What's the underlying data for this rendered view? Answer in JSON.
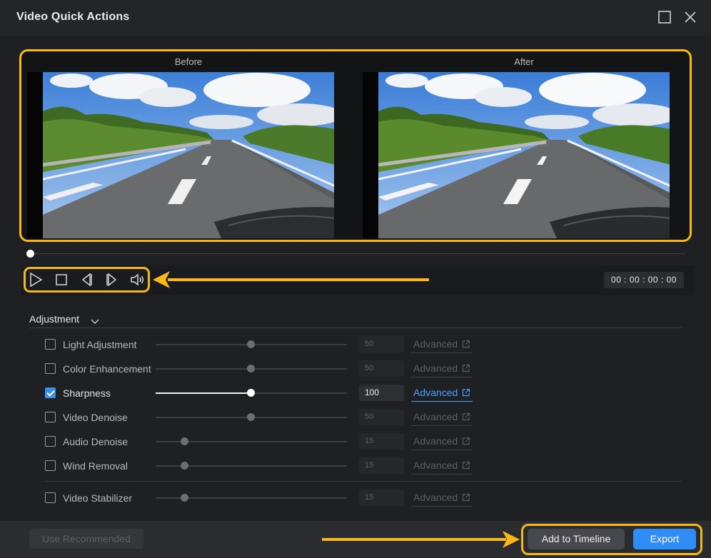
{
  "window": {
    "title": "Video Quick Actions"
  },
  "preview": {
    "before_label": "Before",
    "after_label": "After"
  },
  "player": {
    "timecode": "00 : 00 : 00 : 00",
    "scrub_position": 0.0
  },
  "adjustment": {
    "header": "Adjustment",
    "rows": [
      {
        "label": "Light Adjustment",
        "checked": false,
        "value": "50",
        "slider": 0.5,
        "advanced": "Advanced"
      },
      {
        "label": "Color Enhancement",
        "checked": false,
        "value": "50",
        "slider": 0.5,
        "advanced": "Advanced"
      },
      {
        "label": "Sharpness",
        "checked": true,
        "value": "100",
        "slider": 0.5,
        "advanced": "Advanced"
      },
      {
        "label": "Video Denoise",
        "checked": false,
        "value": "50",
        "slider": 0.5,
        "advanced": "Advanced"
      },
      {
        "label": "Audio Denoise",
        "checked": false,
        "value": "15",
        "slider": 0.15,
        "advanced": "Advanced"
      },
      {
        "label": "Wind Removal",
        "checked": false,
        "value": "15",
        "slider": 0.15,
        "advanced": "Advanced"
      },
      {
        "label": "Video Stabilizer",
        "checked": false,
        "value": "15",
        "slider": 0.15,
        "advanced": "Advanced"
      }
    ]
  },
  "footer": {
    "use_recommended": "Use Recommended",
    "add_to_timeline": "Add to Timeline",
    "export": "Export"
  },
  "colors": {
    "highlight": "#f8b918",
    "accent": "#2f8df5",
    "link": "#4aa3ff"
  }
}
